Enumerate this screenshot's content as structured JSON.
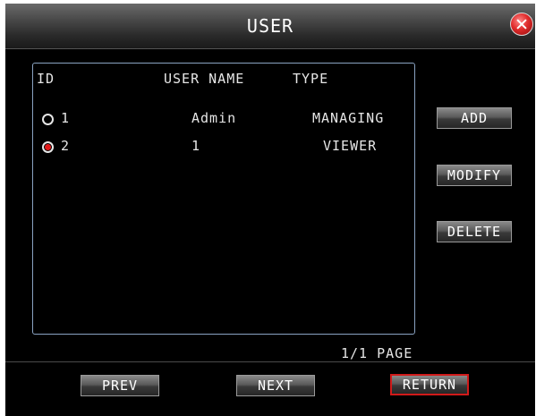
{
  "window": {
    "title": "USER"
  },
  "list": {
    "headers": {
      "id": "ID",
      "user_name": "USER NAME",
      "type": "TYPE"
    },
    "rows": [
      {
        "id": "1",
        "user_name": "Admin",
        "type": "MANAGING",
        "selected": false
      },
      {
        "id": "2",
        "user_name": "1",
        "type": "VIEWER",
        "selected": true
      }
    ]
  },
  "actions": {
    "add": "ADD",
    "modify": "MODIFY",
    "delete": "DELETE"
  },
  "pagination": {
    "page_info": "1/1 PAGE",
    "prev": "PREV",
    "next": "NEXT",
    "return": "RETURN"
  },
  "colors": {
    "accent": "#e21a1a",
    "panel_border": "#8aa3c2"
  }
}
